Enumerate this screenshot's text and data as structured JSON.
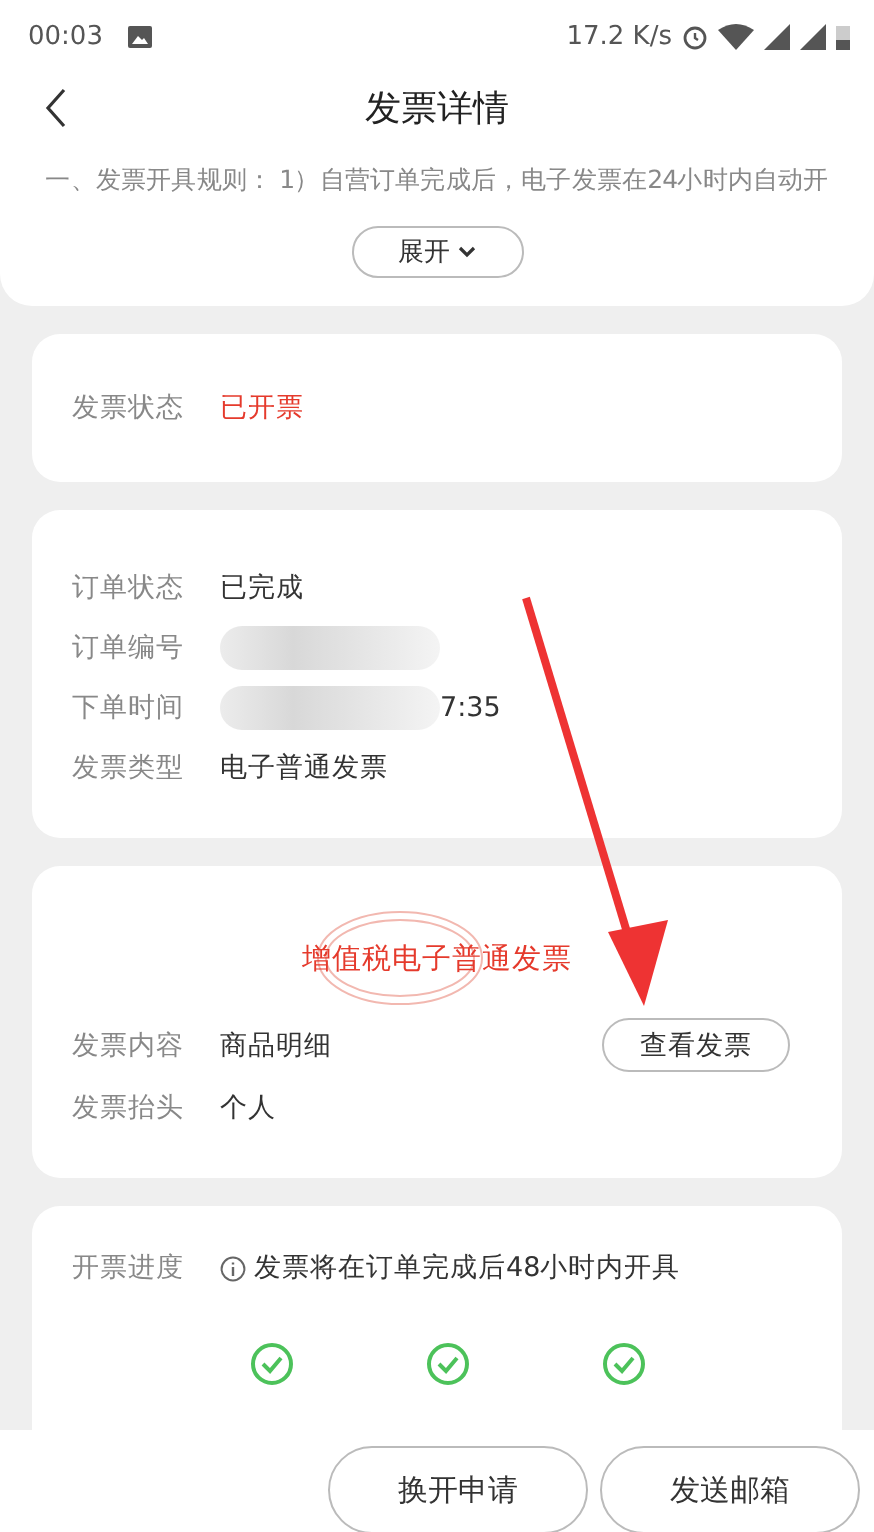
{
  "status_bar": {
    "time": "00:03",
    "speed": "17.2 K/s"
  },
  "header": {
    "title": "发票详情"
  },
  "rules": {
    "text": "一、发票开具规则： 1）自营订单完成后，电子发票在24小时内自动开",
    "toggle": "展开"
  },
  "invoice_status": {
    "label": "发票状态",
    "value": "已开票"
  },
  "order": [
    {
      "label": "订单状态",
      "value": "已完成",
      "blurred": false
    },
    {
      "label": "订单编号",
      "blurred": true
    },
    {
      "label": "下单时间",
      "value": "7:35",
      "blurred": true
    },
    {
      "label": "发票类型",
      "value": "电子普通发票",
      "blurred": false
    }
  ],
  "invoice": {
    "stamp": "增值税电子普通发票",
    "view_button": "查看发票",
    "rows": [
      {
        "label": "发票内容",
        "value": "商品明细"
      },
      {
        "label": "发票抬头",
        "value": "个人"
      }
    ]
  },
  "progress": {
    "label": "开票进度",
    "note": "发票将在订单完成后48小时内开具"
  },
  "actions": [
    "换开申请",
    "发送邮箱"
  ]
}
